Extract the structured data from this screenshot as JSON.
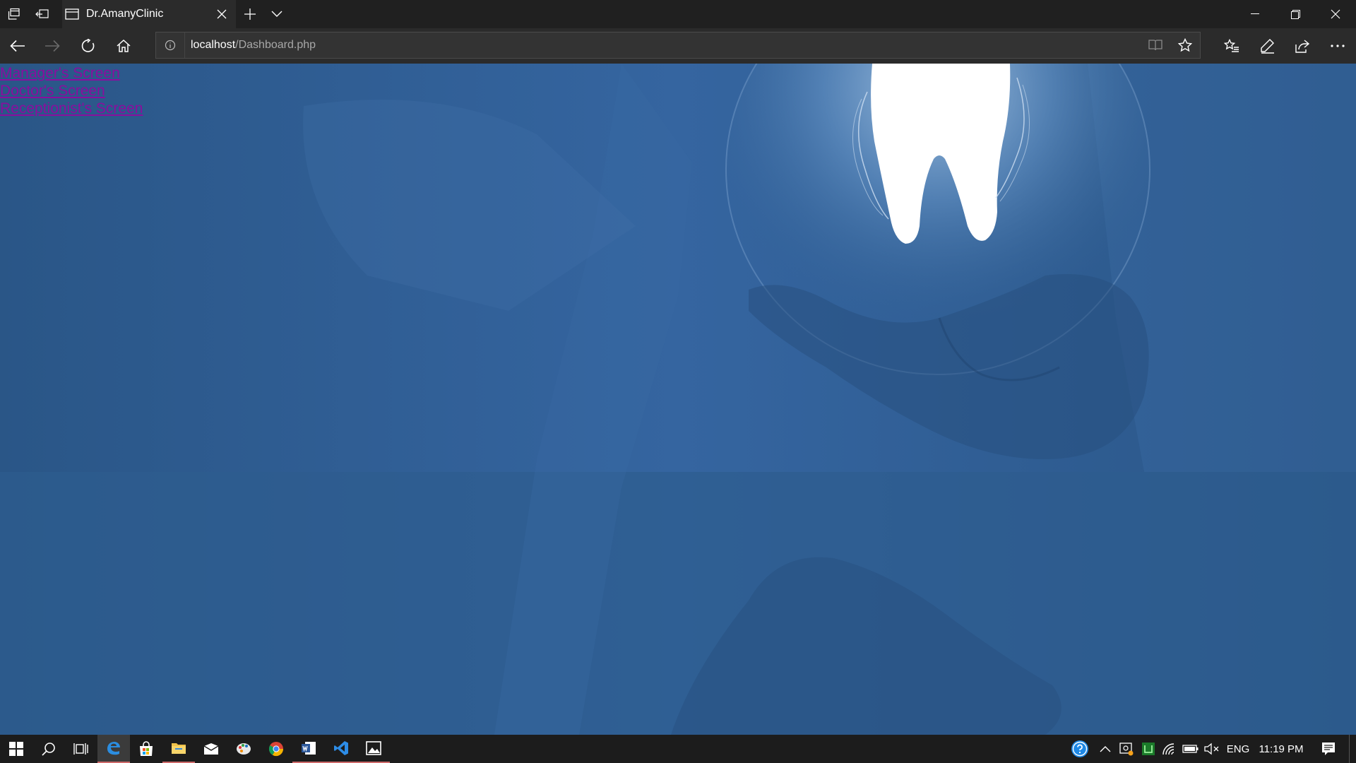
{
  "browser": {
    "tab_title": "Dr.AmanyClinic",
    "address": {
      "host": "localhost",
      "path": "/Dashboard.php"
    }
  },
  "page": {
    "links": [
      {
        "label": "Manager's Screen"
      },
      {
        "label": "Doctor's Screen"
      },
      {
        "label": "Receptionist's Screen"
      }
    ],
    "colors": {
      "background_blue": "#2f5e90",
      "link_visited": "#8a0e9e"
    }
  },
  "taskbar": {
    "apps": [
      "windows-start-icon",
      "search-icon",
      "task-view-icon",
      "edge-icon",
      "store-icon",
      "file-explorer-icon",
      "mail-icon",
      "paint-icon",
      "chrome-icon",
      "word-icon",
      "vscode-icon",
      "photos-icon"
    ],
    "tray": {
      "language": "ENG",
      "time": "11:19 PM"
    }
  }
}
